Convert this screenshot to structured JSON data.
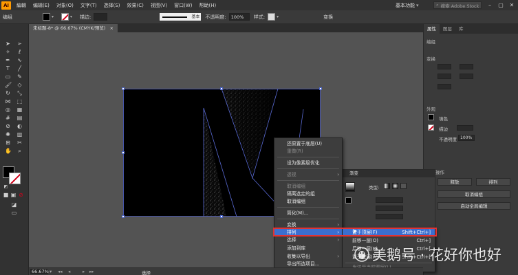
{
  "app": {
    "logo": "Ai"
  },
  "menubar": {
    "items": [
      "編輯",
      "编辑(E)",
      "对象(O)",
      "文字(T)",
      "选择(S)",
      "效果(C)",
      "视图(V)",
      "窗口(W)",
      "帮助(H)"
    ],
    "workspace": "基本功能",
    "search_placeholder": "搜索 Adobe Stock"
  },
  "controlbar": {
    "selection_label": "编组",
    "stroke_label": "描边:",
    "stroke_style": "基本",
    "opacity_label": "不透明度:",
    "opacity_value": "100%",
    "style_label": "样式:",
    "transform_label": "变换"
  },
  "document": {
    "tab_title": "未标题-8* @ 66.67% (CMYK/预览)"
  },
  "status": {
    "zoom": "66.67%",
    "tool_name": "选择"
  },
  "right_panel": {
    "tabs": [
      "属性",
      "图层",
      "库"
    ],
    "group_label": "编组",
    "transform_label": "变换",
    "appearance_label": "外观",
    "fill_label": "填色",
    "stroke_label": "描边",
    "opacity_label": "不透明度",
    "opacity_value": "100%",
    "quick_actions_label": "快速操作",
    "release_button": "释放",
    "arrange_button": "排列",
    "ungroup_button": "取消编组",
    "recolor_button": "启动全局编辑"
  },
  "gradient_panel": {
    "title": "渐变",
    "type_label": "类型:"
  },
  "context_menu": {
    "items": [
      {
        "label": "还原置于底层(U)",
        "disabled": false,
        "submenu": false
      },
      {
        "label": "重做(R)",
        "disabled": true,
        "submenu": false
      },
      {
        "label": "设为像素级优化",
        "disabled": false,
        "submenu": false
      },
      {
        "label": "透视",
        "disabled": true,
        "submenu": true
      },
      {
        "label": "取消编组",
        "disabled": true,
        "submenu": false
      },
      {
        "label": "隔离选定的组",
        "disabled": false,
        "submenu": false
      },
      {
        "label": "取消编组",
        "disabled": false,
        "submenu": false
      },
      {
        "label": "简化(M)...",
        "disabled": false,
        "submenu": false
      },
      {
        "label": "变换",
        "disabled": false,
        "submenu": true
      },
      {
        "label": "排列",
        "disabled": false,
        "submenu": true
      },
      {
        "label": "选择",
        "disabled": false,
        "submenu": true
      },
      {
        "label": "添加到库",
        "disabled": false,
        "submenu": false
      },
      {
        "label": "收集以导出",
        "disabled": false,
        "submenu": true
      },
      {
        "label": "导出所选项目...",
        "disabled": false,
        "submenu": false
      }
    ]
  },
  "arrange_submenu": {
    "items": [
      {
        "label": "置于顶层(F)",
        "shortcut": "Shift+Ctrl+]",
        "disabled": false
      },
      {
        "label": "前移一层(O)",
        "shortcut": "Ctrl+]",
        "disabled": false
      },
      {
        "label": "后移一层(B)",
        "shortcut": "Ctrl+[",
        "disabled": false
      },
      {
        "label": "置于底层(A)",
        "shortcut": "Shift+Ctrl+[",
        "disabled": false
      },
      {
        "label": "发送至当前图层(L)",
        "shortcut": "",
        "disabled": true
      }
    ]
  },
  "watermark": {
    "text": "美鹅号 · 花好你也好"
  },
  "colors": {
    "highlight_outline": "#e23333",
    "selection_blue": "#3b6fd0",
    "app_orange": "#ff9a00"
  }
}
